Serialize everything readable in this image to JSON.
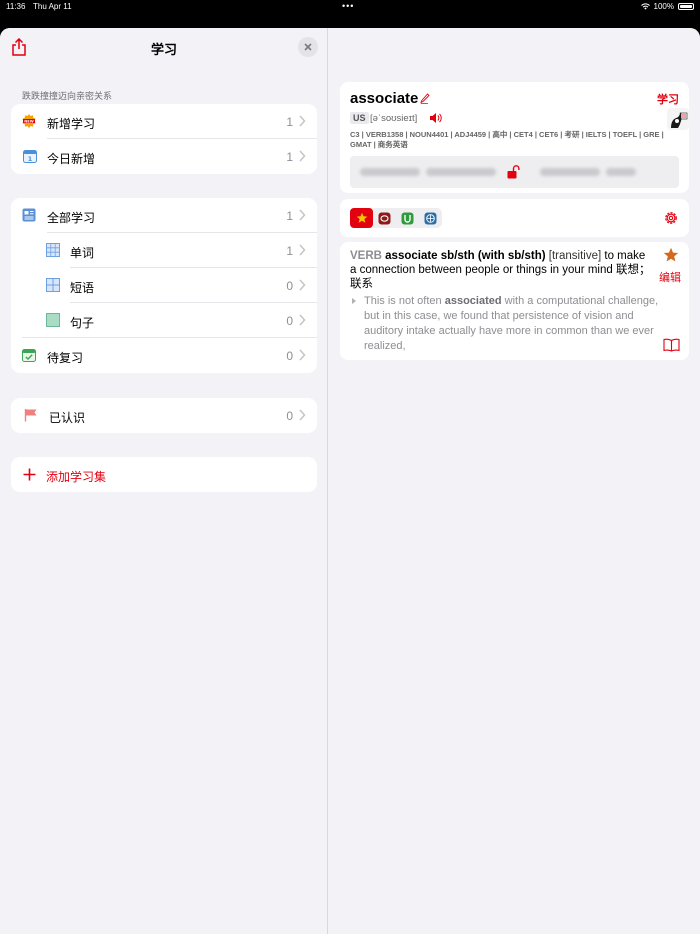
{
  "status_bar": {
    "time": "11:36",
    "date": "Thu Apr 11",
    "battery": "100%"
  },
  "left": {
    "title": "学习",
    "section_header": "跌跌撞撞迈向亲密关系",
    "group1": [
      {
        "label": "新增学习",
        "count": "1",
        "icon": "new-badge-icon"
      },
      {
        "label": "今日新增",
        "count": "1",
        "icon": "calendar-icon"
      }
    ],
    "group2": [
      {
        "label": "全部学习",
        "count": "1",
        "icon": "list-icon"
      },
      {
        "label": "单词",
        "count": "1",
        "icon": "grid-icon"
      },
      {
        "label": "短语",
        "count": "0",
        "icon": "quad-grid-icon"
      },
      {
        "label": "句子",
        "count": "0",
        "icon": "square-icon"
      },
      {
        "label": "待复习",
        "count": "0",
        "icon": "calendar-check-icon"
      }
    ],
    "group3": [
      {
        "label": "已认识",
        "count": "0",
        "icon": "flag-icon"
      }
    ],
    "add_label": "添加学习集"
  },
  "right": {
    "word": "associate",
    "study_link": "学习",
    "accent": "US",
    "phonetic": "[əˈsoʊsieɪt]",
    "tags": "C3 | VERB1358 | NOUN4401 | ADJ4459 | 高中 | CET4 | CET6 | 考研 | IELTS | TOEFL | GRE | GMAT | 商务英语",
    "definition": {
      "pos": "VERB",
      "headword": "associate sb/sth (with sb/sth)",
      "grammar": "[transitive]",
      "meaning": " to make a connection between people or things in your mind 联想；联系",
      "example_pre": "This is not often ",
      "example_bold": "associated",
      "example_post": " with a computational challenge, but in this case, we found that persistence of vision and auditory intake actually have more in common than we ever realized,",
      "edit_label": "编辑"
    }
  },
  "colors": {
    "accent": "#e3000f",
    "background": "#f2f2f7"
  }
}
